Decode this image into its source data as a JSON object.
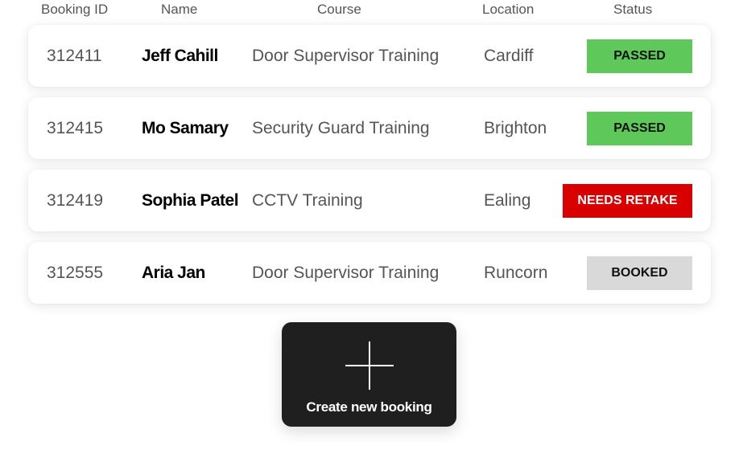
{
  "table": {
    "headers": {
      "booking_id": "Booking ID",
      "name": "Name",
      "course": "Course",
      "location": "Location",
      "status": "Status"
    },
    "rows": [
      {
        "booking_id": "312411",
        "name": "Jeff Cahill",
        "course": "Door Supervisor Training",
        "location": "Cardiff",
        "status": "PASSED"
      },
      {
        "booking_id": "312415",
        "name": "Mo Samary",
        "course": "Security Guard Training",
        "location": "Brighton",
        "status": "PASSED"
      },
      {
        "booking_id": "312419",
        "name": "Sophia Patel",
        "course": "CCTV Training",
        "location": "Ealing",
        "status": "NEEDS RETAKE"
      },
      {
        "booking_id": "312555",
        "name": "Aria Jan",
        "course": "Door Supervisor Training",
        "location": "Runcorn",
        "status": "BOOKED"
      }
    ]
  },
  "create_button": {
    "label": "Create new booking",
    "icon": "plus-icon"
  },
  "colors": {
    "passed": "#5ec95a",
    "needs_retake": "#d90000",
    "booked": "#d9d9d9",
    "button_bg": "#1f1f1f"
  }
}
